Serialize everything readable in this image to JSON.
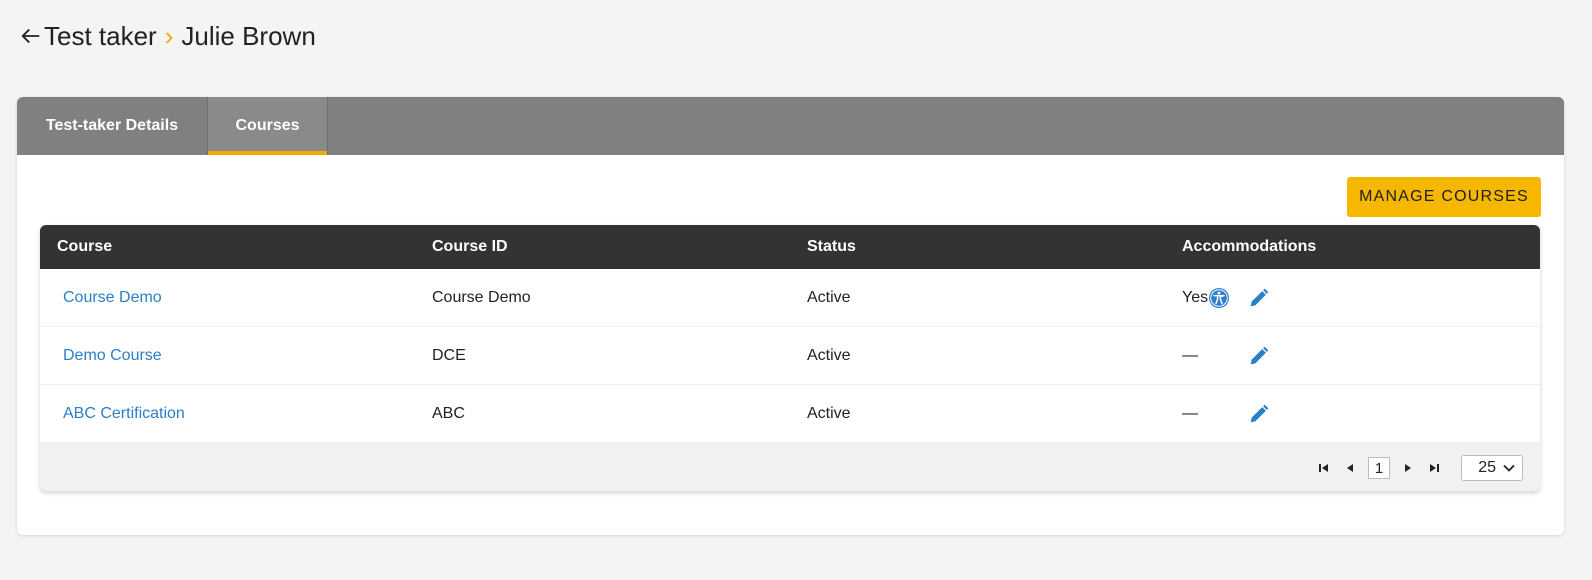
{
  "breadcrumb": {
    "parent": "Test taker",
    "separator": "›",
    "current": "Julie Brown"
  },
  "tabs": [
    {
      "label": "Test-taker Details",
      "active": false
    },
    {
      "label": "Courses",
      "active": true
    }
  ],
  "actions": {
    "manage_courses": "MANAGE COURSES"
  },
  "table": {
    "headers": [
      "Course",
      "Course ID",
      "Status",
      "Accommodations"
    ],
    "rows": [
      {
        "course": "Course Demo",
        "course_id": "Course Demo",
        "status": "Active",
        "accommodations": "Yes",
        "accessibility_icon": true
      },
      {
        "course": "Demo Course",
        "course_id": "DCE",
        "status": "Active",
        "accommodations": "—",
        "accessibility_icon": false
      },
      {
        "course": "ABC Certification",
        "course_id": "ABC",
        "status": "Active",
        "accommodations": "—",
        "accessibility_icon": false
      }
    ]
  },
  "pagination": {
    "current_page": "1",
    "page_size": "25"
  },
  "colors": {
    "accent": "#f2a900",
    "button": "#f5b700",
    "link": "#2a7fc9",
    "tabbar": "#808080",
    "table_header": "#333333"
  },
  "icons": {
    "back": "arrow-left-icon",
    "accessibility": "accessibility-icon",
    "edit": "pencil-icon",
    "first": "first-page-icon",
    "prev": "prev-page-icon",
    "next": "next-page-icon",
    "last": "last-page-icon",
    "dropdown": "chevron-down-icon"
  }
}
